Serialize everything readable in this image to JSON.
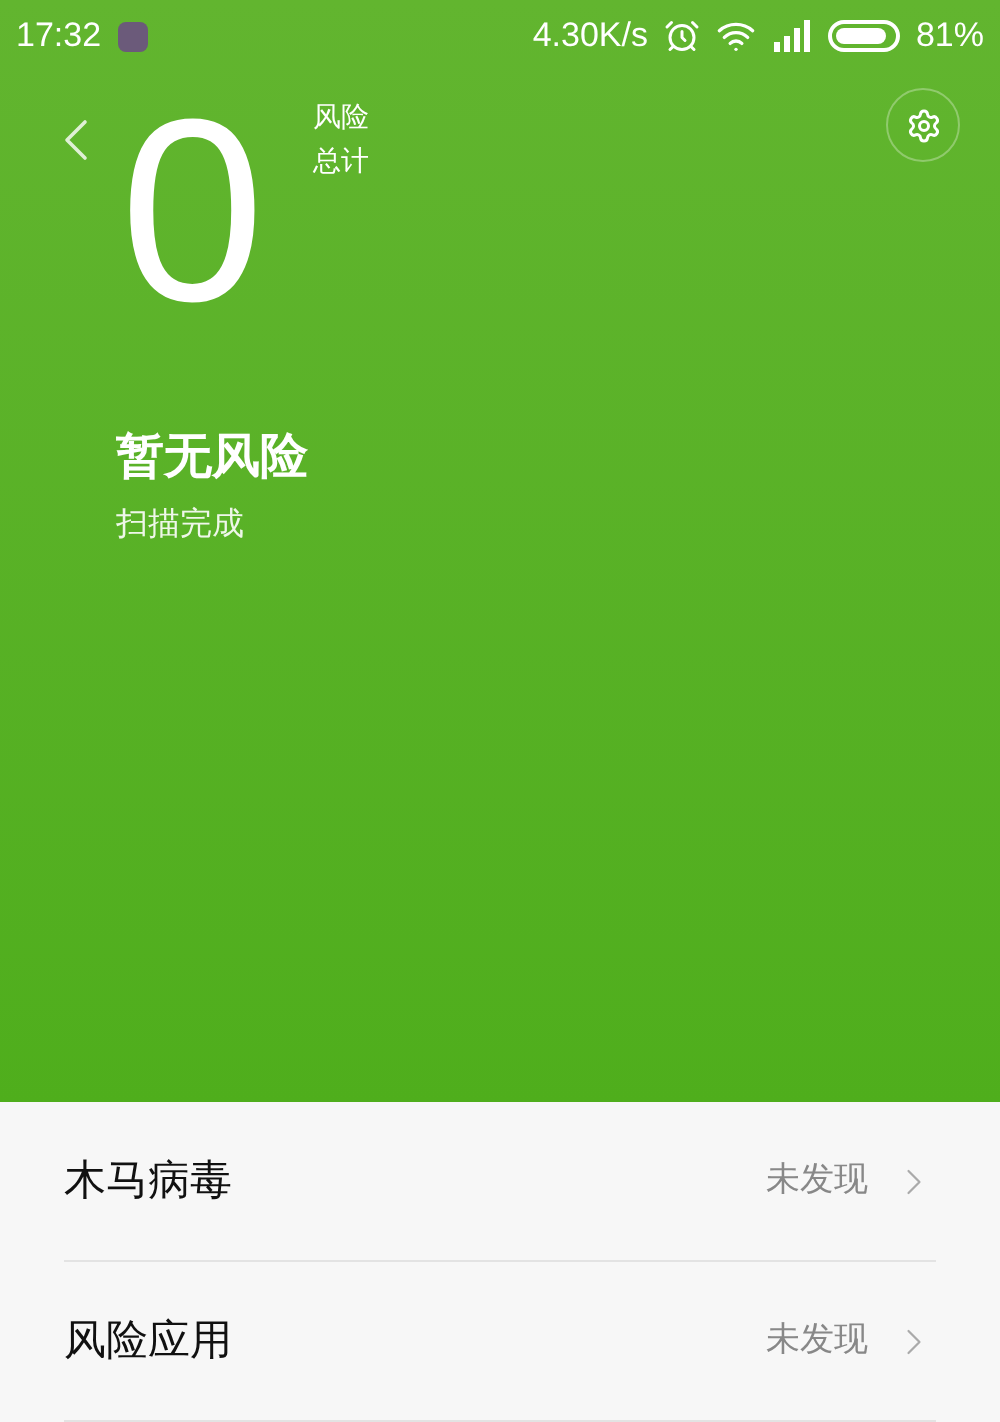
{
  "status_bar": {
    "time": "17:32",
    "speed": "4.30K/s",
    "battery": "81%"
  },
  "summary": {
    "count": "0",
    "count_label": [
      "风险",
      "总计"
    ],
    "title": "暂无风险",
    "subtitle": "扫描完成"
  },
  "items": [
    {
      "label": "木马病毒",
      "value": "未发现"
    },
    {
      "label": "风险应用",
      "value": "未发现"
    }
  ]
}
